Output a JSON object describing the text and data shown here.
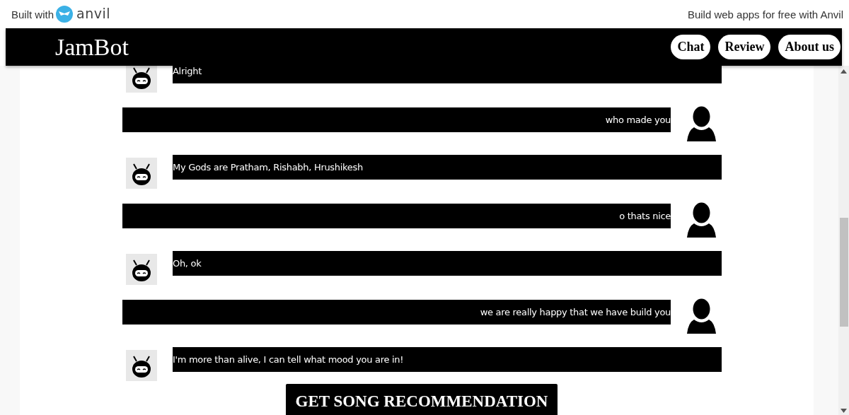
{
  "top_bar": {
    "built_with": "Built with",
    "logo_text": "anvil",
    "promo": "Build web apps for free with Anvil"
  },
  "header": {
    "title": "JamBot",
    "nav": [
      {
        "label": "Chat"
      },
      {
        "label": "Review"
      },
      {
        "label": "About us"
      }
    ]
  },
  "messages": [
    {
      "kind": "bot",
      "text": "Alright"
    },
    {
      "kind": "user",
      "text": "who made you"
    },
    {
      "kind": "bot",
      "text": "My Gods are Pratham, Rishabh, Hrushikesh"
    },
    {
      "kind": "user",
      "text": "o thats nice"
    },
    {
      "kind": "bot",
      "text": "Oh, ok"
    },
    {
      "kind": "user",
      "text": "we are really happy that we have build you"
    },
    {
      "kind": "bot",
      "text": "I'm more than alive, I can tell what mood you are in!"
    }
  ],
  "action_button": "GET SONG RECOMMENDATION"
}
